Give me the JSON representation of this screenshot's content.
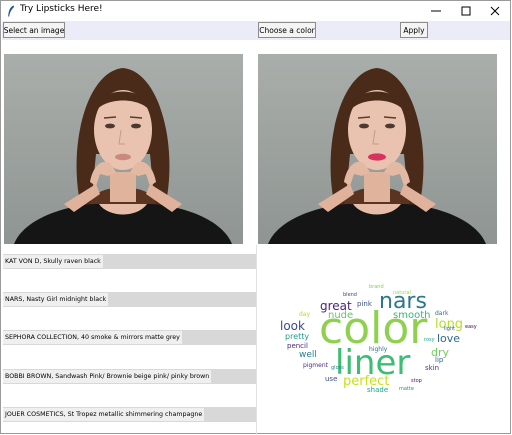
{
  "window": {
    "title": "Try Lipsticks Here!",
    "icon": "feather-icon",
    "controls": [
      "minimize-icon",
      "maximize-icon",
      "close-icon"
    ]
  },
  "toolbar": {
    "select_image_label": "Select an image",
    "choose_color_label": "Choose a color",
    "apply_label": "Apply"
  },
  "images": {
    "original": {
      "lip_color": "#c88a80"
    },
    "result": {
      "lip_color": "#d6335f"
    }
  },
  "products": [
    "KAT VON D, Skully raven black",
    "NARS, Nasty Girl midnight black",
    "SEPHORA COLLECTION, 40 smoke & mirrors matte grey",
    "BOBBI BROWN, Sandwash Pink/ Brownie beige pink/ pinky brown",
    "JOUER COSMETICS, St Tropez metallic shimmering champagne"
  ],
  "wordcloud": {
    "words": [
      {
        "text": "color",
        "color": "#8fd14f"
      },
      {
        "text": "liner",
        "color": "#3dbc74"
      },
      {
        "text": "nars",
        "color": "#2a788e"
      },
      {
        "text": "long",
        "color": "#b5de2b"
      },
      {
        "text": "perfect",
        "color": "#c8e020"
      },
      {
        "text": "look",
        "color": "#3e4a89"
      },
      {
        "text": "great",
        "color": "#482677"
      },
      {
        "text": "nude",
        "color": "#5ec962"
      },
      {
        "text": "smooth",
        "color": "#35b779"
      },
      {
        "text": "love",
        "color": "#31688e"
      },
      {
        "text": "dry",
        "color": "#6ece58"
      },
      {
        "text": "well",
        "color": "#26828e"
      },
      {
        "text": "pretty",
        "color": "#1f9e89"
      },
      {
        "text": "pencil",
        "color": "#482878"
      },
      {
        "text": "skin",
        "color": "#443983"
      },
      {
        "text": "shade",
        "color": "#20a486"
      },
      {
        "text": "pink",
        "color": "#3b528b"
      },
      {
        "text": "natural",
        "color": "#9fda3a"
      },
      {
        "text": "dark",
        "color": "#2c728e"
      },
      {
        "text": "lip",
        "color": "#31688e"
      },
      {
        "text": "day",
        "color": "#b5de2b"
      },
      {
        "text": "use",
        "color": "#3e4a89"
      },
      {
        "text": "pigment",
        "color": "#472d7b"
      },
      {
        "text": "highly",
        "color": "#2d708e"
      },
      {
        "text": "rosy",
        "color": "#1fa188"
      },
      {
        "text": "light",
        "color": "#38598c"
      },
      {
        "text": "gloss",
        "color": "#25858e"
      },
      {
        "text": "stop",
        "color": "#471063"
      },
      {
        "text": "blend",
        "color": "#414487"
      },
      {
        "text": "brand",
        "color": "#7ad151"
      },
      {
        "text": "easy",
        "color": "#440154"
      },
      {
        "text": "matte",
        "color": "#21918c"
      }
    ]
  }
}
